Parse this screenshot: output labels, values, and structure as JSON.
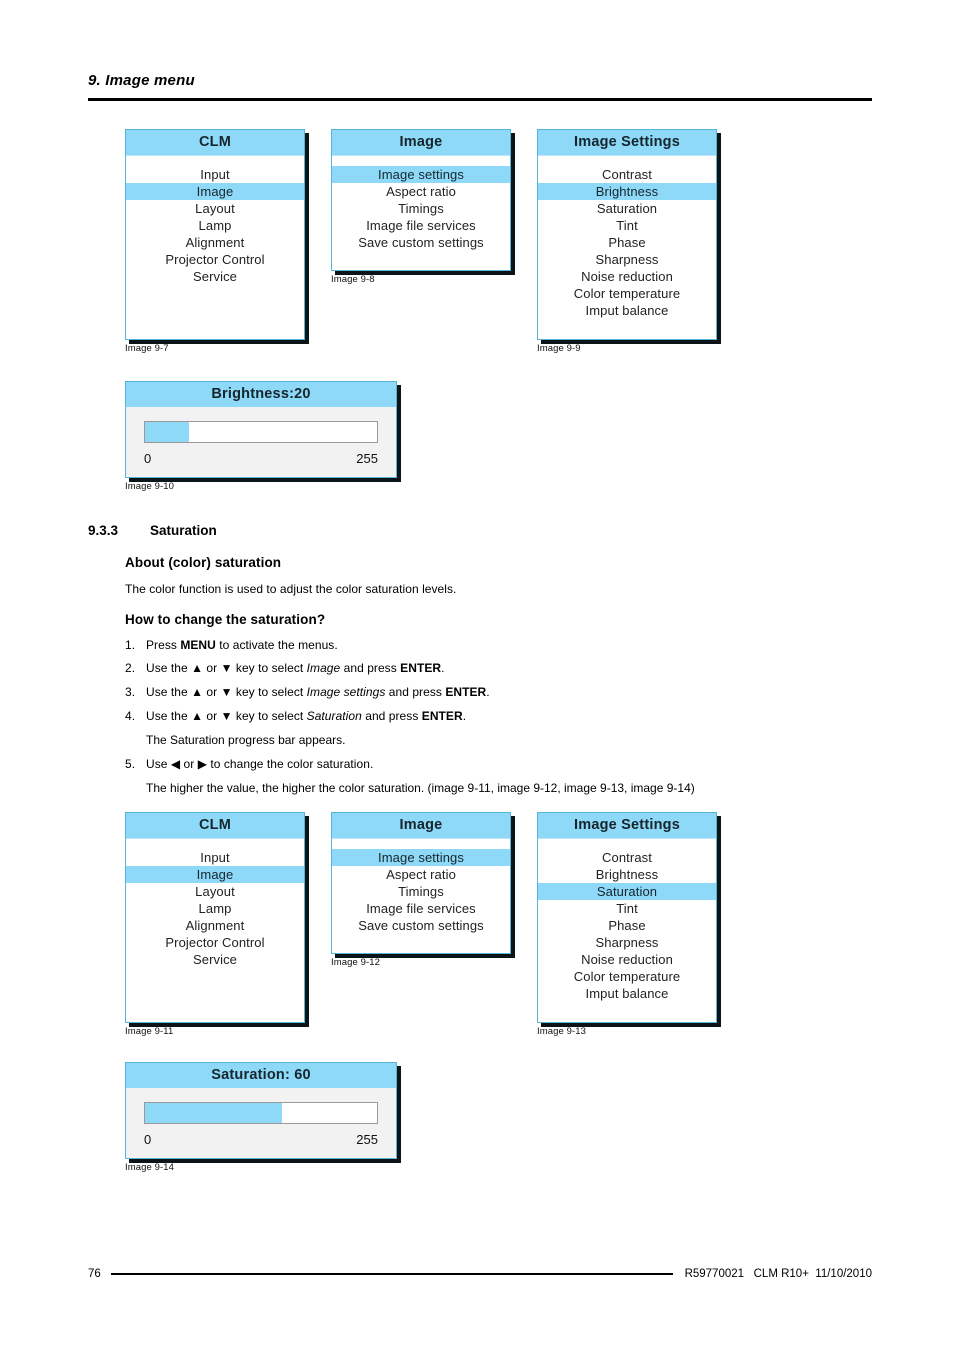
{
  "page": {
    "chapter": "9.  Image menu",
    "footer_page_number": "76",
    "footer_reference": "R59770021   CLM R10+  11/10/2010"
  },
  "colors": {
    "osd_accent": "#8ed8f8",
    "osd_border": "#59b4d9",
    "osd_shadow": "#0b1417",
    "text": "#000000"
  },
  "figures": {
    "fig_9_7": {
      "caption": "Image 9-7",
      "title": "CLM",
      "items": [
        {
          "label": "Input",
          "selected": false
        },
        {
          "label": "Image",
          "selected": true
        },
        {
          "label": "Layout",
          "selected": false
        },
        {
          "label": "Lamp",
          "selected": false
        },
        {
          "label": "Alignment",
          "selected": false
        },
        {
          "label": "Projector Control",
          "selected": false
        },
        {
          "label": "Service",
          "selected": false
        }
      ]
    },
    "fig_9_8": {
      "caption": "Image 9-8",
      "title": "Image",
      "items": [
        {
          "label": "Image settings",
          "selected": true
        },
        {
          "label": "Aspect ratio",
          "selected": false
        },
        {
          "label": "Timings",
          "selected": false
        },
        {
          "label": "Image file services",
          "selected": false
        },
        {
          "label": "Save custom settings",
          "selected": false
        }
      ]
    },
    "fig_9_9": {
      "caption": "Image 9-9",
      "title": "Image Settings",
      "items": [
        {
          "label": "Contrast",
          "selected": false
        },
        {
          "label": "Brightness",
          "selected": true
        },
        {
          "label": "Saturation",
          "selected": false
        },
        {
          "label": "Tint",
          "selected": false
        },
        {
          "label": "Phase",
          "selected": false
        },
        {
          "label": "Sharpness",
          "selected": false
        },
        {
          "label": "Noise reduction",
          "selected": false
        },
        {
          "label": "Color temperature",
          "selected": false
        },
        {
          "label": "Imput balance",
          "selected": false
        }
      ]
    },
    "fig_9_10": {
      "caption": "Image 9-10",
      "title": "Brightness:20",
      "value": 20,
      "min_label": "0",
      "max_label": "255",
      "fill_percent": "19%"
    },
    "fig_9_11": {
      "caption": "Image 9-11",
      "title": "CLM",
      "items": [
        {
          "label": "Input",
          "selected": false
        },
        {
          "label": "Image",
          "selected": true
        },
        {
          "label": "Layout",
          "selected": false
        },
        {
          "label": "Lamp",
          "selected": false
        },
        {
          "label": "Alignment",
          "selected": false
        },
        {
          "label": "Projector Control",
          "selected": false
        },
        {
          "label": "Service",
          "selected": false
        }
      ]
    },
    "fig_9_12": {
      "caption": "Image 9-12",
      "title": "Image",
      "items": [
        {
          "label": "Image settings",
          "selected": true
        },
        {
          "label": "Aspect ratio",
          "selected": false
        },
        {
          "label": "Timings",
          "selected": false
        },
        {
          "label": "Image file services",
          "selected": false
        },
        {
          "label": "Save custom settings",
          "selected": false
        }
      ]
    },
    "fig_9_13": {
      "caption": "Image 9-13",
      "title": "Image Settings",
      "items": [
        {
          "label": "Contrast",
          "selected": false
        },
        {
          "label": "Brightness",
          "selected": false
        },
        {
          "label": "Saturation",
          "selected": true
        },
        {
          "label": "Tint",
          "selected": false
        },
        {
          "label": "Phase",
          "selected": false
        },
        {
          "label": "Sharpness",
          "selected": false
        },
        {
          "label": "Noise reduction",
          "selected": false
        },
        {
          "label": "Color temperature",
          "selected": false
        },
        {
          "label": "Imput balance",
          "selected": false
        }
      ]
    },
    "fig_9_14": {
      "caption": "Image 9-14",
      "title": "Saturation: 60",
      "value": 60,
      "min_label": "0",
      "max_label": "255",
      "fill_percent": "59%"
    }
  },
  "section": {
    "number": "9.3.3",
    "title": "Saturation",
    "about_heading": "About (color) saturation",
    "about_text": "The color function is used to adjust the color saturation levels.",
    "how_heading": "How to change the saturation?",
    "steps": [
      {
        "num": "1.",
        "parts": [
          {
            "t": "Press ",
            "s": "n"
          },
          {
            "t": "MENU",
            "s": "b"
          },
          {
            "t": " to activate the menus.",
            "s": "n"
          }
        ]
      },
      {
        "num": "2.",
        "parts": [
          {
            "t": "Use the ",
            "s": "n"
          },
          {
            "t": "▲",
            "s": "n"
          },
          {
            "t": " or ",
            "s": "n"
          },
          {
            "t": "▼",
            "s": "n"
          },
          {
            "t": " key to select ",
            "s": "n"
          },
          {
            "t": "Image",
            "s": "i"
          },
          {
            "t": " and press ",
            "s": "n"
          },
          {
            "t": "ENTER",
            "s": "b"
          },
          {
            "t": ".",
            "s": "n"
          }
        ]
      },
      {
        "num": "3.",
        "parts": [
          {
            "t": "Use the ",
            "s": "n"
          },
          {
            "t": "▲",
            "s": "n"
          },
          {
            "t": " or ",
            "s": "n"
          },
          {
            "t": "▼",
            "s": "n"
          },
          {
            "t": " key to select ",
            "s": "n"
          },
          {
            "t": "Image settings",
            "s": "i"
          },
          {
            "t": " and press ",
            "s": "n"
          },
          {
            "t": "ENTER",
            "s": "b"
          },
          {
            "t": ".",
            "s": "n"
          }
        ]
      },
      {
        "num": "4.",
        "parts": [
          {
            "t": "Use the ",
            "s": "n"
          },
          {
            "t": "▲",
            "s": "n"
          },
          {
            "t": " or ",
            "s": "n"
          },
          {
            "t": "▼",
            "s": "n"
          },
          {
            "t": " key to select ",
            "s": "n"
          },
          {
            "t": "Saturation",
            "s": "i"
          },
          {
            "t": " and press ",
            "s": "n"
          },
          {
            "t": "ENTER",
            "s": "b"
          },
          {
            "t": ".",
            "s": "n"
          }
        ]
      }
    ],
    "note_after_step4": "The Saturation progress bar appears.",
    "step5": {
      "num": "5.",
      "parts": [
        {
          "t": "Use ",
          "s": "n"
        },
        {
          "t": "◀",
          "s": "n"
        },
        {
          "t": " or ",
          "s": "n"
        },
        {
          "t": "▶",
          "s": "n"
        },
        {
          "t": " to change the color saturation.",
          "s": "n"
        }
      ]
    },
    "note_after_step5": "The higher the value, the higher the color saturation.  (image 9-11, image 9-12, image 9-13, image 9-14)"
  }
}
